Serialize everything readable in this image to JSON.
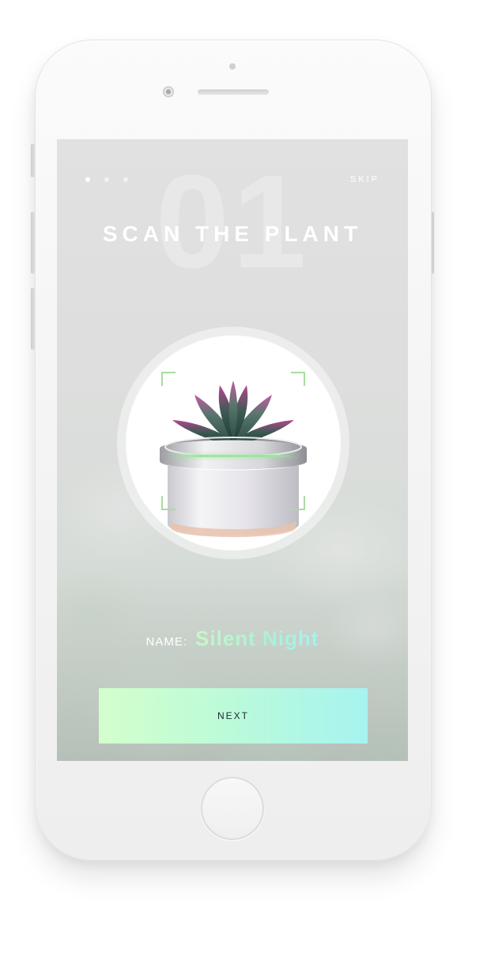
{
  "onboarding": {
    "pager": {
      "total": 3,
      "active": 0
    },
    "skip_label": "SKIP",
    "step_number": "01",
    "title": "SCAN THE PLANT",
    "name_label": "NAME:",
    "plant_name": "Silent Night",
    "next_label": "NEXT"
  },
  "colors": {
    "accent_start": "#d3ffcc",
    "accent_end": "#a6f3f0",
    "scan_frame": "#a8dca0"
  }
}
